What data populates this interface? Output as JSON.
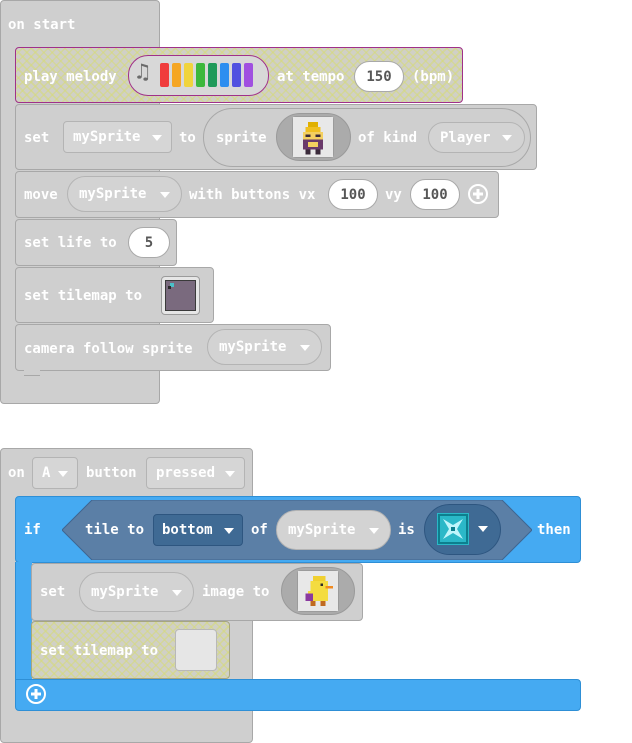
{
  "on_start": {
    "hat_label": "on start",
    "play_melody": {
      "label": "play melody",
      "at_tempo_label": "at tempo",
      "tempo_value": "150",
      "unit_label": "(bpm)",
      "note_colors": [
        "#f03c3c",
        "#f5a623",
        "#f0d43c",
        "#3cb83c",
        "#1f9a5a",
        "#2d8ef0",
        "#5050e0",
        "#a050e0"
      ]
    },
    "set_sprite": {
      "set_label": "set",
      "variable": "mySprite",
      "to_label": "to",
      "sprite_label": "sprite",
      "of_kind_label": "of kind",
      "kind": "Player"
    },
    "move": {
      "move_label": "move",
      "variable": "mySprite",
      "with_buttons_label": "with buttons vx",
      "vx": "100",
      "vy_label": "vy",
      "vy": "100"
    },
    "set_life": {
      "label": "set life to",
      "value": "5"
    },
    "set_tilemap": {
      "label": "set tilemap to"
    },
    "camera_follow": {
      "label": "camera follow sprite",
      "variable": "mySprite"
    }
  },
  "on_button": {
    "on_label": "on",
    "button_name": "A",
    "button_label": "button",
    "event": "pressed",
    "if_block": {
      "if_label": "if",
      "tile_to_label": "tile to",
      "direction": "bottom",
      "of_label": "of",
      "variable": "mySprite",
      "is_label": "is",
      "then_label": "then"
    },
    "set_image": {
      "set_label": "set",
      "variable": "mySprite",
      "image_to_label": "image to"
    },
    "set_tilemap": {
      "label": "set tilemap to"
    }
  },
  "colors": {
    "logic": "#45aaf2",
    "logic_dark": "#2e8fd6",
    "condition": "#5b7fa6",
    "block_gray": "#cfcfcf"
  }
}
